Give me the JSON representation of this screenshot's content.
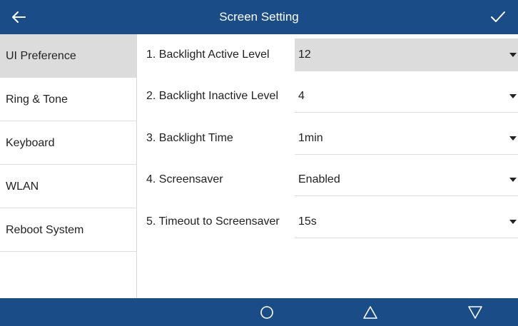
{
  "header": {
    "title": "Screen Setting",
    "back_icon": "arrow-left-icon",
    "confirm_icon": "checkmark-icon"
  },
  "sidebar": {
    "items": [
      {
        "label": "UI Preference",
        "active": true
      },
      {
        "label": "Ring & Tone",
        "active": false
      },
      {
        "label": "Keyboard",
        "active": false
      },
      {
        "label": "WLAN",
        "active": false
      },
      {
        "label": "Reboot System",
        "active": false
      }
    ]
  },
  "settings": [
    {
      "label": "1. Backlight Active Level",
      "value": "12"
    },
    {
      "label": "2. Backlight Inactive Level",
      "value": "4"
    },
    {
      "label": "3. Backlight Time",
      "value": "1min"
    },
    {
      "label": "4. Screensaver",
      "value": "Enabled"
    },
    {
      "label": "5. Timeout to Screensaver",
      "value": "15s"
    }
  ],
  "navbar": {
    "icons": [
      "home-circle-icon",
      "triangle-up-icon",
      "triangle-down-icon"
    ]
  },
  "colors": {
    "bar_blue": "#1a4d88",
    "selected_gray": "#dcdcdc"
  }
}
